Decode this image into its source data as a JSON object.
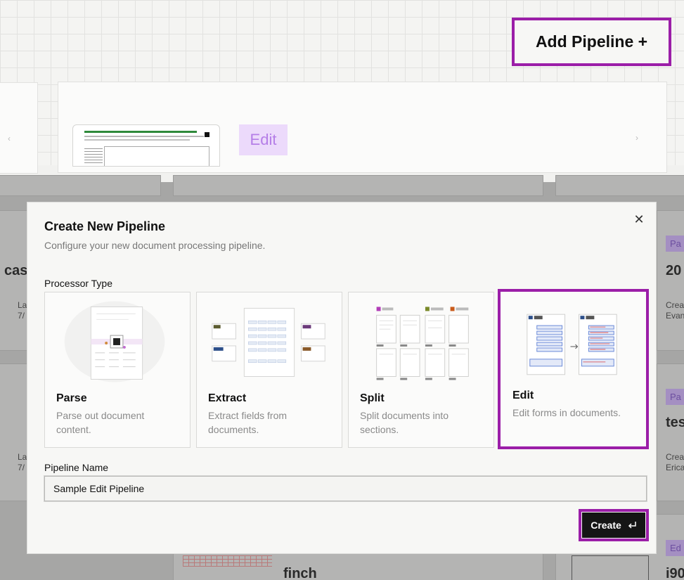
{
  "header": {
    "add_pipeline_label": "Add Pipeline +"
  },
  "top_card": {
    "edit_badge": "Edit"
  },
  "background": {
    "cards": [
      {
        "name": "cas",
        "meta_label": "La",
        "meta_value": "7/"
      },
      {
        "name": "20",
        "meta_label": "Crea",
        "meta_value": "Evan",
        "badge": "Pa"
      },
      {
        "name": "",
        "meta_label": "La",
        "meta_value": "7/"
      },
      {
        "name": "tes",
        "meta_label": "Crea",
        "meta_value": "Erica",
        "badge": "Pa"
      },
      {
        "name": "finch"
      },
      {
        "name": "i90",
        "badge": "Ed"
      }
    ]
  },
  "modal": {
    "title": "Create New Pipeline",
    "subtitle": "Configure your new document processing pipeline.",
    "processor_type_label": "Processor Type",
    "processor_types": [
      {
        "name": "Parse",
        "description": "Parse out document content.",
        "selected": false,
        "icon": "parse-illustration"
      },
      {
        "name": "Extract",
        "description": "Extract fields from documents.",
        "selected": false,
        "icon": "extract-illustration"
      },
      {
        "name": "Split",
        "description": "Split documents into sections.",
        "selected": false,
        "icon": "split-illustration"
      },
      {
        "name": "Edit",
        "description": "Edit forms in documents.",
        "selected": true,
        "icon": "edit-illustration"
      }
    ],
    "pipeline_name_label": "Pipeline Name",
    "pipeline_name_value": "Sample Edit Pipeline",
    "create_label": "Create",
    "close_icon": "close-icon",
    "enter_icon": "enter-icon"
  },
  "colors": {
    "highlight": "#9b1ea8",
    "edit_badge_bg": "#ecdafb",
    "create_bg": "#151515"
  }
}
